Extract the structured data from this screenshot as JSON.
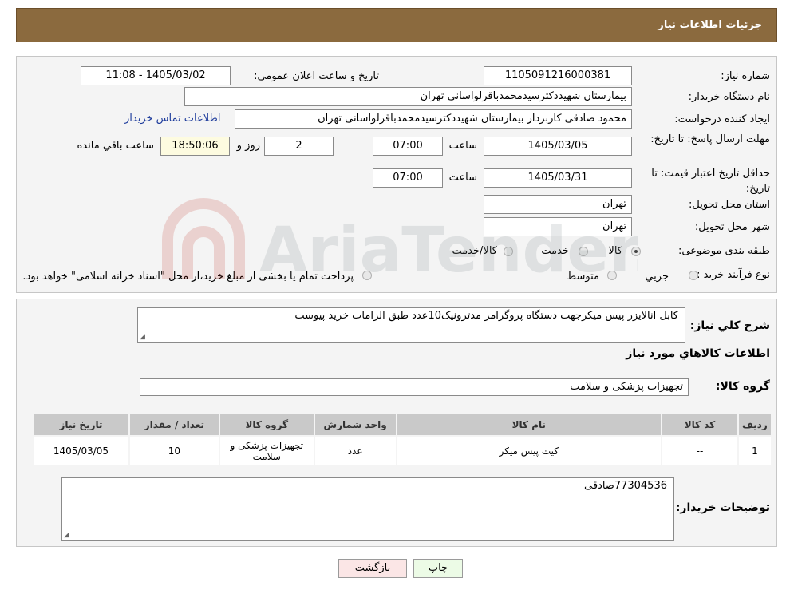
{
  "header": {
    "title": "جزئیات اطلاعات نیاز"
  },
  "form": {
    "need_number": {
      "label": "شماره نیاز:",
      "value": "1105091216000381"
    },
    "announce_datetime": {
      "label": "تاريخ و ساعت اعلان عمومي:",
      "value": "1405/03/02 - 11:08"
    },
    "buyer_org": {
      "label": "نام دستگاه خريدار:",
      "value": "بیمارستان شهیددکترسیدمحمدباقرلواسانی تهران"
    },
    "requester": {
      "label": "ايجاد کننده درخواست:",
      "value": "محمود صادقی کاربرداز بیمارستان شهیددکترسیدمحمدباقرلواسانی تهران"
    },
    "contact_link": "اطلاعات تماس خريدار",
    "reply_deadline": {
      "label": "مهلت ارسال پاسخ: تا تاريخ:",
      "date": "1405/03/05",
      "time_label": "ساعت",
      "time": "07:00",
      "days": "2",
      "days_label": "روز و",
      "remaining": "18:50:06",
      "remaining_label": "ساعت باقي مانده"
    },
    "price_validity": {
      "label": "حداقل تاريخ اعتبار قيمت: تا تاريخ:",
      "date": "1405/03/31",
      "time_label": "ساعت",
      "time": "07:00"
    },
    "province": {
      "label": "استان محل تحويل:",
      "value": "تهران"
    },
    "city": {
      "label": "شهر محل تحويل:",
      "value": "تهران"
    },
    "category": {
      "label": "طبقه بندی موضوعی:",
      "options": [
        "کالا",
        "خدمت",
        "کالا/خدمت"
      ],
      "selected": "کالا"
    },
    "purchase_type": {
      "label": "نوع فرآیند خرید :",
      "options": [
        "جزيي",
        "متوسط"
      ],
      "note": "پرداخت تمام يا بخشی از مبلغ خريد،از محل \"اسناد خزانه اسلامی\" خواهد بود."
    }
  },
  "description": {
    "label": "شرح كلي نياز:",
    "value": "كابل انالايزر پيس ميكرجهت دستگاه پروگرامر مدترونيک10عدد طبق الزامات خريد پيوست"
  },
  "goods_section_title": "اطلاعات کالاهاي مورد نياز",
  "goods_group": {
    "label": "گروه کالا:",
    "value": "تجهيزات پزشکی و سلامت"
  },
  "table": {
    "headers": [
      "رديف",
      "کد کالا",
      "نام کالا",
      "واحد شمارش",
      "گروه کالا",
      "تعداد / مقدار",
      "تاريخ نياز"
    ],
    "rows": [
      [
        "1",
        "--",
        "کیت پیس میکر",
        "عدد",
        "تجهیزات پزشکی و سلامت",
        "10",
        "1405/03/05"
      ]
    ]
  },
  "buyer_notes": {
    "label": "توضيحات خريدار:",
    "value": "77304536صادقی"
  },
  "buttons": {
    "print": "چاپ",
    "back": "بازگشت"
  },
  "colors": {
    "header": "#8b6a3e",
    "print_button": "#ecfbe6",
    "back_button": "#fbe6e6"
  },
  "watermark": {
    "text": "AriaTender.neT"
  }
}
